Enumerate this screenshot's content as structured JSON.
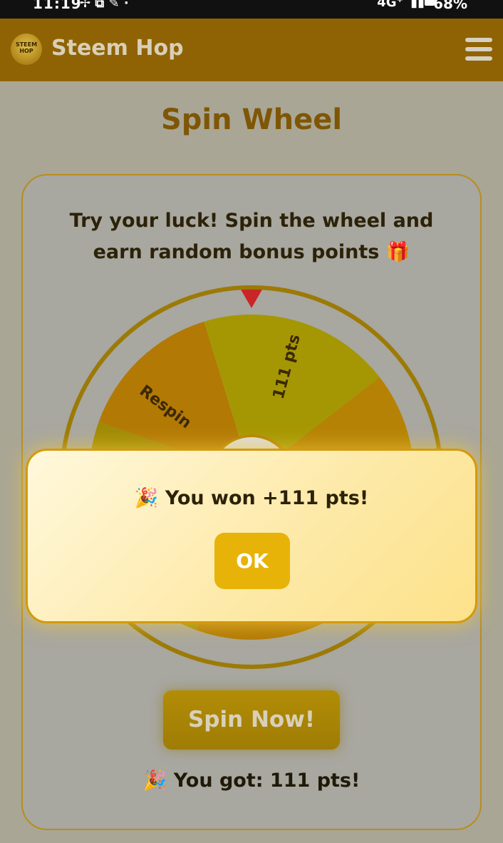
{
  "status_bar": {
    "time": "11:19",
    "icons": [
      "grid-icon",
      "chat-icon",
      "pin-icon",
      "dot-icon"
    ],
    "network": "4G⁺",
    "battery": "68%"
  },
  "header": {
    "logo_text": "STEEM HOP",
    "app_name": "Steem Hop",
    "menu_icon": "hamburger-icon"
  },
  "page": {
    "title": "Spin Wheel",
    "intro": "Try your luck! Spin the wheel and earn random bonus points 🎁",
    "wheel": {
      "segments": [
        {
          "label": "Respin",
          "color": "#b27905"
        },
        {
          "label": "111 pts",
          "color": "#a59703"
        },
        {
          "label": "",
          "color": "#b58205"
        }
      ],
      "pointer_icon": "down-triangle-icon"
    },
    "spin_button": "Spin Now!",
    "result": "🎉 You got: 111 pts!"
  },
  "modal": {
    "message": "🎉 You won +111 pts!",
    "ok_button": "OK"
  },
  "colors": {
    "accent": "#e8b308",
    "header": "#8f6303",
    "title": "#7f5605"
  }
}
